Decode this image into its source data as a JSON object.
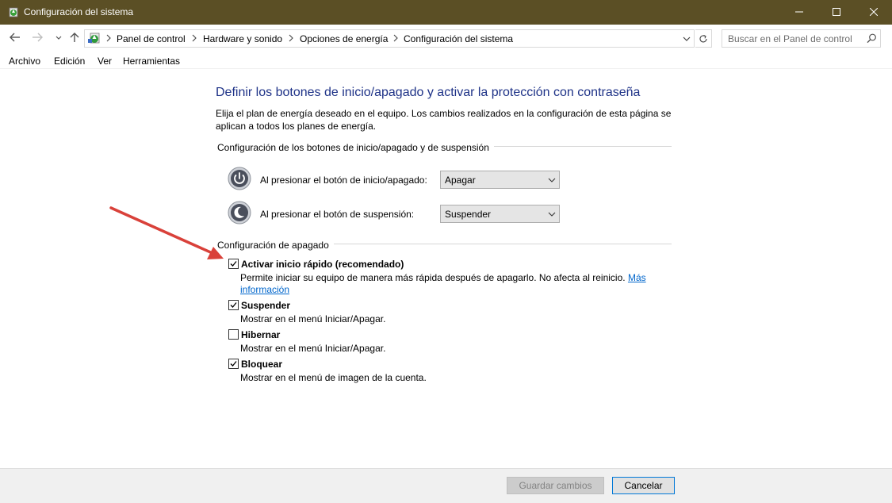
{
  "window": {
    "title": "Configuración del sistema",
    "titlebar_color": "#5b4f25"
  },
  "navigation": {
    "breadcrumb": [
      "Panel de control",
      "Hardware y sonido",
      "Opciones de energía",
      "Configuración del sistema"
    ],
    "search_placeholder": "Buscar en el Panel de control"
  },
  "menu": {
    "items": [
      "Archivo",
      "Edición",
      "Ver",
      "Herramientas"
    ]
  },
  "page": {
    "heading": "Definir los botones de inicio/apagado y activar la protección con contraseña",
    "description": "Elija el plan de energía deseado en el equipo. Los cambios realizados en la configuración de esta página se aplican a todos los planes de energía.",
    "heading_color": "#1e3287"
  },
  "buttons_section": {
    "title": "Configuración de los botones de inicio/apagado y de suspensión",
    "rows": [
      {
        "label": "Al presionar el botón de inicio/apagado:",
        "value": "Apagar",
        "icon": "power-icon"
      },
      {
        "label": "Al presionar el botón de suspensión:",
        "value": "Suspender",
        "icon": "sleep-icon"
      }
    ]
  },
  "shutdown_section": {
    "title": "Configuración de apagado",
    "options": [
      {
        "label": "Activar inicio rápido (recomendado)",
        "checked": true,
        "description": "Permite iniciar su equipo de manera más rápida después de apagarlo. No afecta al reinicio.",
        "link_line1": "Más",
        "link_line2": "información"
      },
      {
        "label": "Suspender",
        "checked": true,
        "description": "Mostrar en el menú Iniciar/Apagar."
      },
      {
        "label": "Hibernar",
        "checked": false,
        "description": "Mostrar en el menú Iniciar/Apagar."
      },
      {
        "label": "Bloquear",
        "checked": true,
        "description": "Mostrar en el menú de imagen de la cuenta."
      }
    ]
  },
  "footer": {
    "save_label": "Guardar cambios",
    "save_enabled": false,
    "cancel_label": "Cancelar"
  },
  "annotation": {
    "arrow_color": "#d9413a"
  }
}
